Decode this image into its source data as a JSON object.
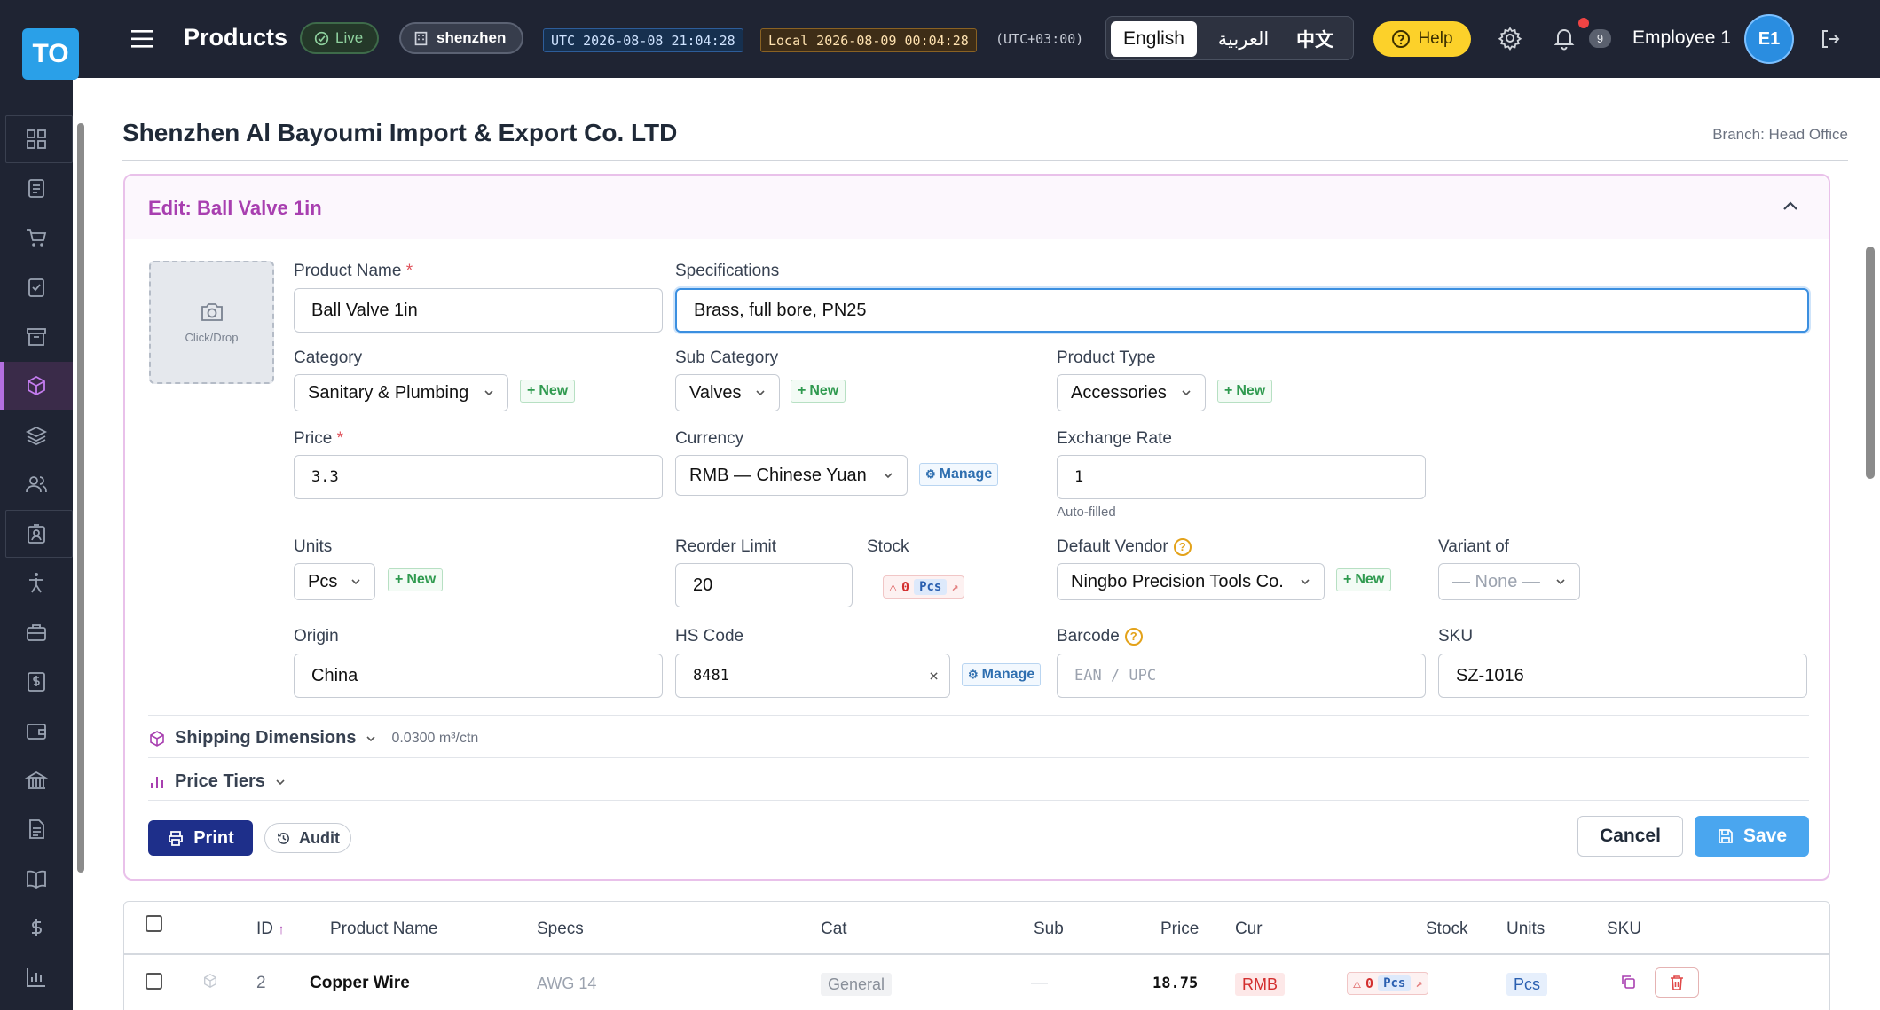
{
  "app": {
    "logo_text": "TO",
    "page_title": "Products",
    "live_label": "Live",
    "branch_pill": "shenzhen",
    "utc_clock": "UTC 2026-08-08 21:04:28",
    "local_clock": "Local 2026-08-09 00:04:28",
    "tz_offset": "(UTC+03:00)",
    "languages": [
      "English",
      "العربية",
      "中文"
    ],
    "active_language": "English",
    "help_label": "Help",
    "notification_count": "9",
    "employee_name": "Employee 1",
    "avatar_initials": "E1"
  },
  "sidebar": {
    "items": [
      "dashboard-icon",
      "clipboard-icon",
      "cart-icon",
      "clipboard-check-icon",
      "archive-icon",
      "cube-icon",
      "layers-icon",
      "users-icon",
      "badge-icon",
      "person-icon",
      "briefcase-icon",
      "dollar-doc-icon",
      "wallet-icon",
      "bank-icon",
      "document-icon",
      "book-icon",
      "dollar-icon",
      "chart-icon"
    ],
    "active": "cube-icon"
  },
  "header": {
    "company": "Shenzhen Al Bayoumi Import & Export Co. LTD",
    "branch": "Branch: Head Office"
  },
  "form": {
    "title": "Edit: Ball Valve 1in",
    "photo_hint": "Click/Drop",
    "product_name": {
      "label": "Product Name",
      "value": "Ball Valve 1in"
    },
    "specifications": {
      "label": "Specifications",
      "value": "Brass, full bore, PN25"
    },
    "category": {
      "label": "Category",
      "value": "Sanitary & Plumbing"
    },
    "sub_category": {
      "label": "Sub Category",
      "value": "Valves"
    },
    "product_type": {
      "label": "Product Type",
      "value": "Accessories"
    },
    "price": {
      "label": "Price",
      "value": "3.3"
    },
    "currency": {
      "label": "Currency",
      "value": "RMB — Chinese Yuan"
    },
    "exchange_rate": {
      "label": "Exchange Rate",
      "value": "1",
      "hint": "Auto-filled"
    },
    "units": {
      "label": "Units",
      "value": "Pcs"
    },
    "reorder_limit": {
      "label": "Reorder Limit",
      "value": "20"
    },
    "stock": {
      "label": "Stock",
      "value": "0",
      "unit": "Pcs"
    },
    "default_vendor": {
      "label": "Default Vendor",
      "value": "Ningbo Precision Tools Co."
    },
    "variant_of": {
      "label": "Variant of",
      "value": "— None —"
    },
    "origin": {
      "label": "Origin",
      "value": "China"
    },
    "hs_code": {
      "label": "HS Code",
      "value": "8481"
    },
    "barcode": {
      "label": "Barcode",
      "placeholder": "EAN / UPC"
    },
    "sku": {
      "label": "SKU",
      "value": "SZ-1016"
    },
    "new_label": "New",
    "manage_label": "Manage",
    "required_mark": "*",
    "shipping": {
      "label": "Shipping Dimensions",
      "summary": "0.0300 m³/ctn"
    },
    "price_tiers": {
      "label": "Price Tiers"
    },
    "print_label": "Print",
    "audit_label": "Audit",
    "cancel_label": "Cancel",
    "save_label": "Save"
  },
  "table": {
    "columns": [
      "ID",
      "Product Name",
      "Specs",
      "Cat",
      "Sub",
      "Price",
      "Cur",
      "Stock",
      "Units",
      "SKU"
    ],
    "sort_indicator": "↑",
    "rows": [
      {
        "id": "2",
        "name": "Copper Wire",
        "specs": "AWG 14",
        "cat": "General",
        "sub": "—",
        "price": "18.75",
        "cur": "RMB",
        "stock": "0",
        "stock_unit": "Pcs",
        "units": "Pcs"
      }
    ]
  },
  "colors": {
    "topbar": "#1f2433",
    "accent_purple": "#a83fb0",
    "save_blue": "#4aa6ef",
    "print_navy": "#1e2f8a",
    "help_yellow": "#fcd12a"
  }
}
